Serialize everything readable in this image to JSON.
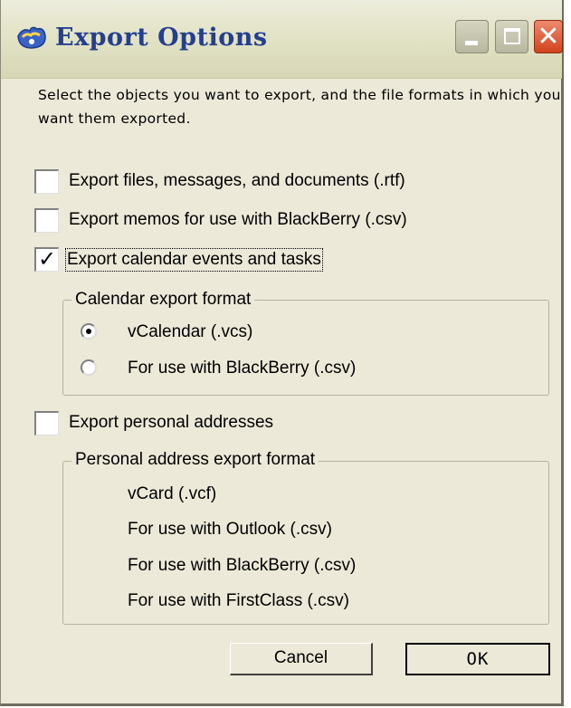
{
  "window": {
    "title": "Export Options",
    "icon": "app-icon"
  },
  "intro": "Select the objects you want to export, and the file formats in which you want them exported.",
  "options": {
    "files": {
      "label": "Export files, messages, and documents (.rtf)",
      "checked": false
    },
    "memos": {
      "label": "Export memos for use with BlackBerry (.csv)",
      "checked": false
    },
    "calendar": {
      "label": "Export calendar events and tasks",
      "checked": true
    },
    "addresses": {
      "label": "Export personal addresses",
      "checked": false
    }
  },
  "calendar_format": {
    "legend": "Calendar export format",
    "choices": [
      {
        "label": "vCalendar (.vcs)",
        "selected": true
      },
      {
        "label": "For use with BlackBerry (.csv)",
        "selected": false
      }
    ]
  },
  "address_format": {
    "legend": "Personal address export format",
    "choices": [
      "vCard (.vcf)",
      "For use with Outlook (.csv)",
      "For use with BlackBerry (.csv)",
      "For use with FirstClass (.csv)"
    ]
  },
  "buttons": {
    "cancel": "Cancel",
    "ok": "OK"
  },
  "colors": {
    "title_text": "#253f8f",
    "close_button": "#d1431e",
    "dialog_bg": "#ece9d8"
  }
}
